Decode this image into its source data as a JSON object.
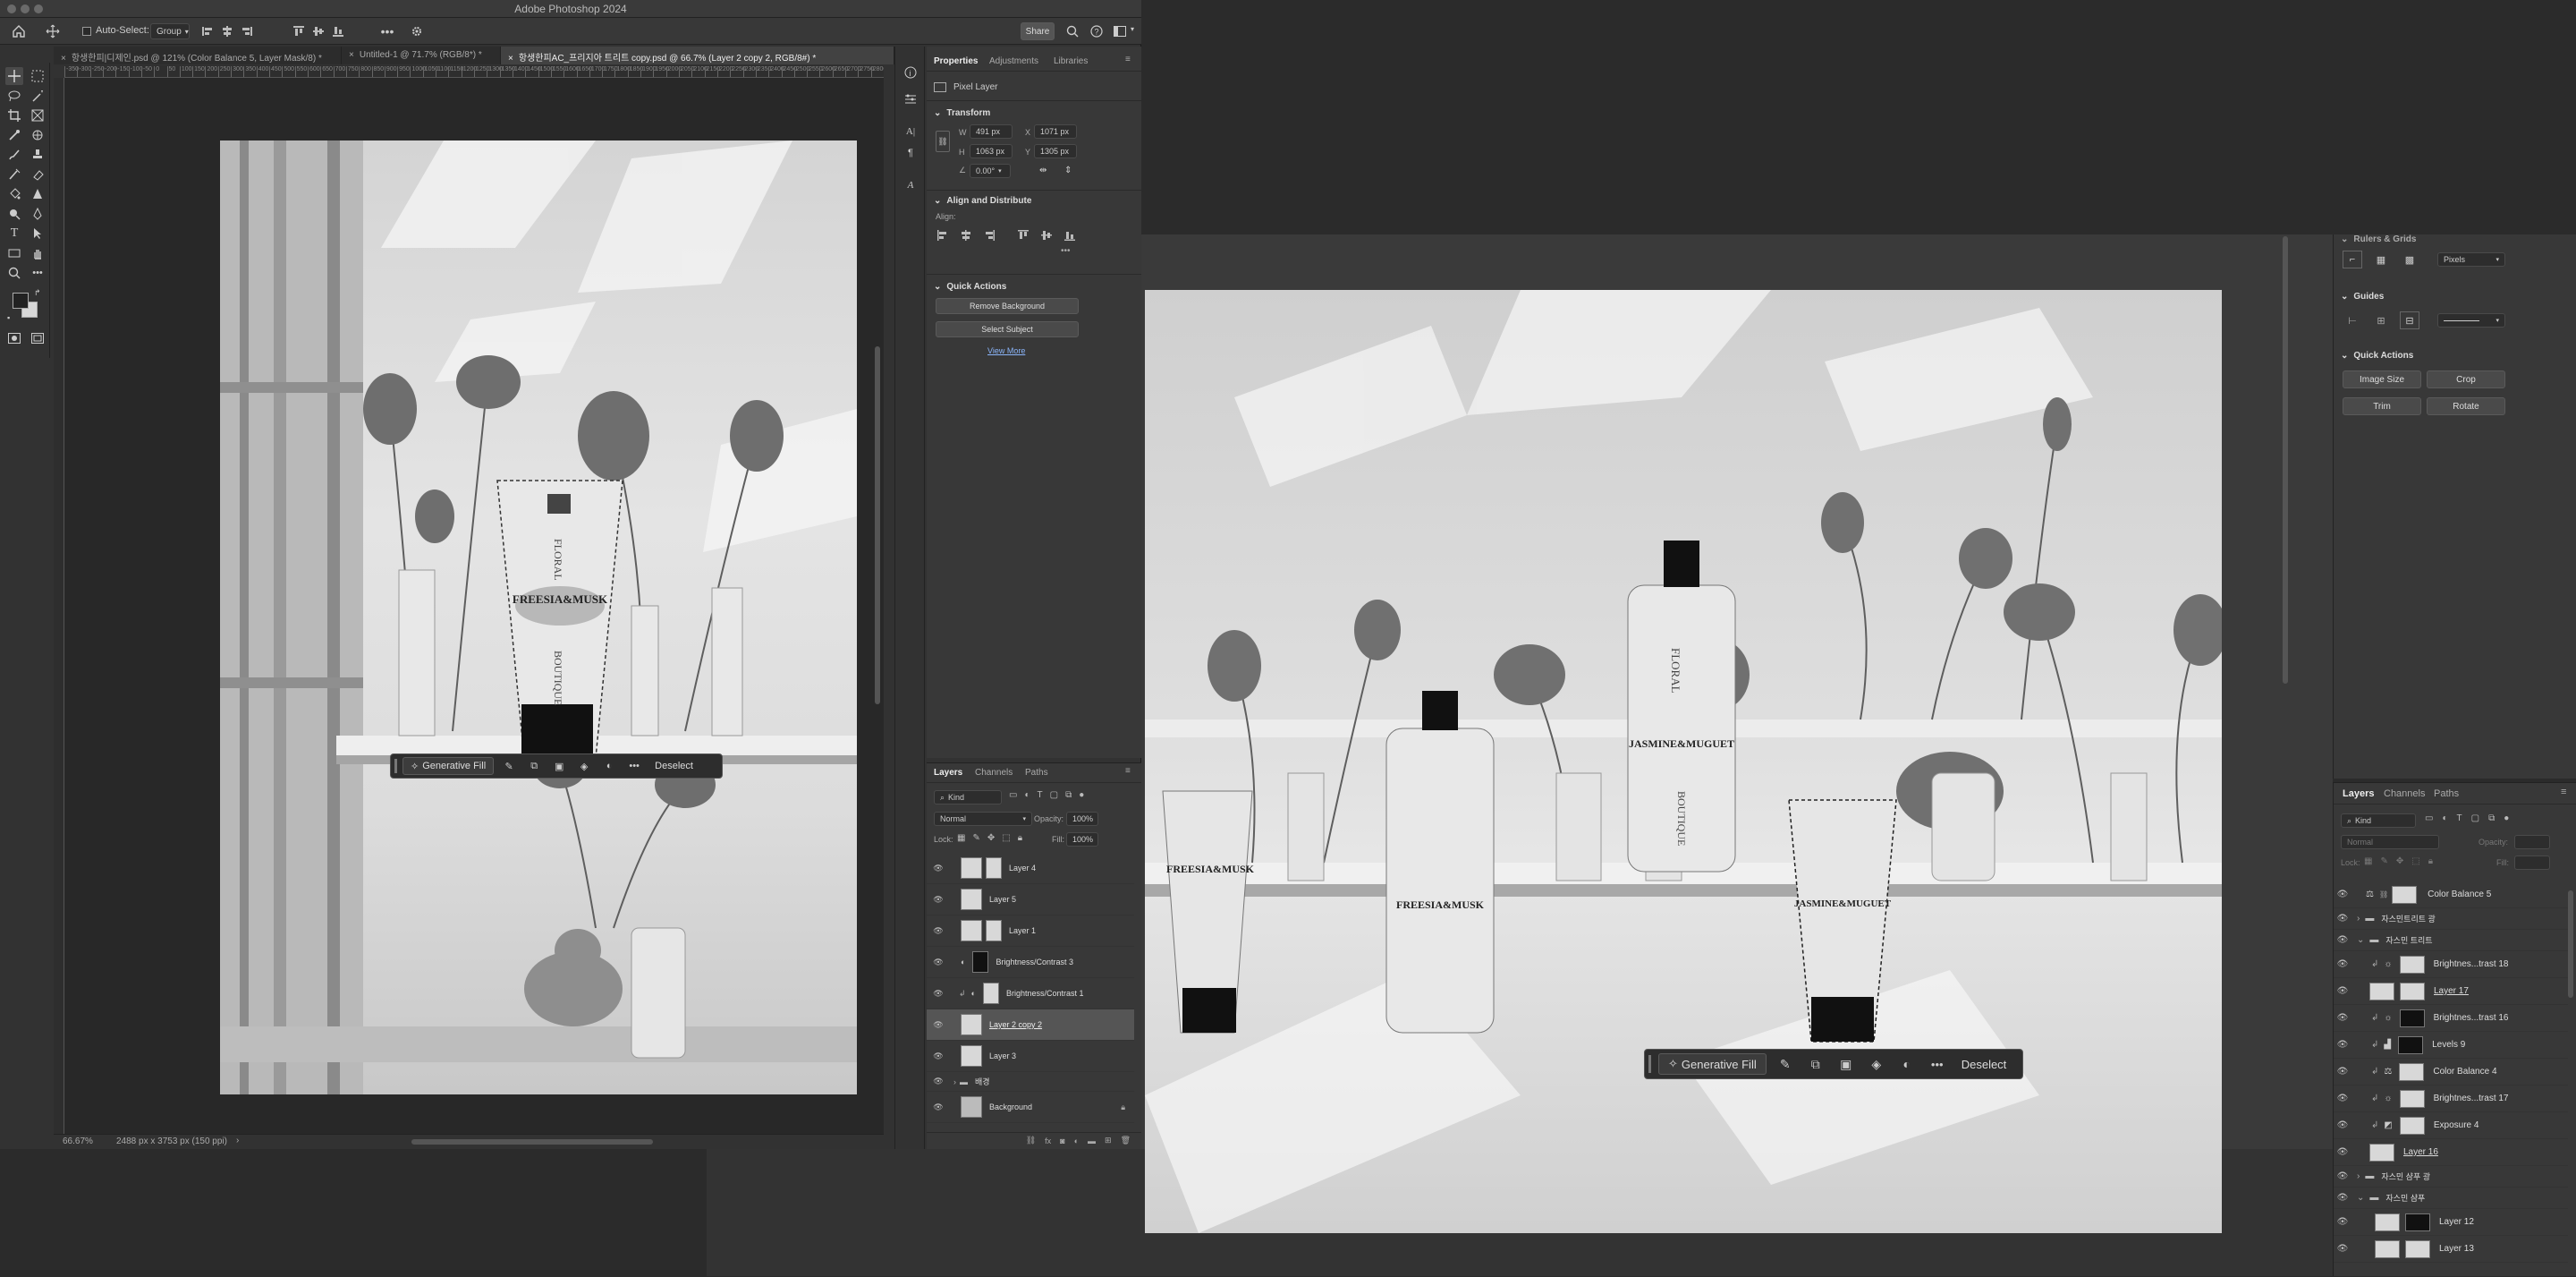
{
  "app": {
    "title": "Adobe Photoshop 2024"
  },
  "options_bar": {
    "auto_select_label": "Auto-Select:",
    "group_value": "Group",
    "share_label": "Share"
  },
  "tabs": [
    {
      "label": "항생한피|디제인.psd @ 121% (Color Balance 5, Layer Mask/8) *"
    },
    {
      "label": "Untitled-1 @ 71.7% (RGB/8*) *"
    },
    {
      "label": "항생한피AC_프리지아 트리트 copy.psd @ 66.7% (Layer 2 copy 2, RGB/8#) *"
    }
  ],
  "ruler_numbers": [
    "-350",
    "-300",
    "-250",
    "-200",
    "-150",
    "-100",
    "-50",
    "0",
    "50",
    "100",
    "150",
    "200",
    "250",
    "300",
    "350",
    "400",
    "450",
    "500",
    "550",
    "600",
    "650",
    "700",
    "750",
    "800",
    "850",
    "900",
    "950",
    "1000",
    "1050",
    "1100",
    "1150",
    "1200",
    "1250",
    "1300",
    "1350",
    "1400",
    "1450",
    "1500",
    "1550",
    "1600",
    "1650",
    "1700",
    "1750",
    "1800",
    "1850",
    "1900",
    "1950",
    "2000",
    "2050",
    "2100",
    "2150",
    "2200",
    "2250",
    "2300",
    "2350",
    "2400",
    "2450",
    "2500",
    "2550",
    "2600",
    "2650",
    "2700",
    "2750",
    "2800"
  ],
  "status_bar": {
    "zoom": "66.67%",
    "doc_info": "2488 px x 3753 px (150 ppi)"
  },
  "properties": {
    "tabs": [
      "Properties",
      "Adjustments",
      "Libraries"
    ],
    "layer_type": "Pixel Layer",
    "transform_title": "Transform",
    "w_label": "W",
    "w_value": "491 px",
    "x_label": "X",
    "x_value": "1071 px",
    "h_label": "H",
    "h_value": "1063 px",
    "y_label": "Y",
    "y_value": "1305 px",
    "angle_value": "0.00°",
    "align_title": "Align and Distribute",
    "align_label": "Align:",
    "quick_title": "Quick Actions",
    "remove_bg": "Remove Background",
    "select_subject": "Select Subject",
    "view_more": "View More"
  },
  "contextual_bar": {
    "generative_fill": "Generative Fill",
    "deselect": "Deselect"
  },
  "layers_panel": {
    "tabs": [
      "Layers",
      "Channels",
      "Paths"
    ],
    "kind": "Kind",
    "blend": "Normal",
    "opacity_label": "Opacity:",
    "opacity_value": "100%",
    "lock_label": "Lock:",
    "fill_label": "Fill:",
    "fill_value": "100%",
    "layers": [
      {
        "name": "Layer 4"
      },
      {
        "name": "Layer 5"
      },
      {
        "name": "Layer 1"
      },
      {
        "name": "Brightness/Contrast 3"
      },
      {
        "name": "Brightness/Contrast 1"
      },
      {
        "name": "Layer 2 copy 2"
      },
      {
        "name": "Layer 3"
      },
      {
        "name": "배경"
      },
      {
        "name": "Background"
      }
    ]
  },
  "right_props": {
    "rulers_title": "Rulers & Grids",
    "units": "Pixels",
    "guides_title": "Guides",
    "quick_title": "Quick Actions",
    "image_size": "Image Size",
    "crop": "Crop",
    "trim": "Trim",
    "rotate": "Rotate"
  },
  "right_layers": {
    "tabs": [
      "Layers",
      "Channels",
      "Paths"
    ],
    "kind": "Kind",
    "blend": "Normal",
    "opacity_label": "Opacity:",
    "fill_label": "Fill:",
    "lock_label": "Lock:",
    "layers": [
      {
        "name": "Color Balance 5"
      },
      {
        "name": "자스민트리트 광"
      },
      {
        "name": "자스민 트리트"
      },
      {
        "name": "Brightnes...trast 18"
      },
      {
        "name": "Layer 17"
      },
      {
        "name": "Brightnes...trast 16"
      },
      {
        "name": "Levels 9"
      },
      {
        "name": "Color Balance 4"
      },
      {
        "name": "Brightnes...trast 17"
      },
      {
        "name": "Exposure 4"
      },
      {
        "name": "Layer 16"
      },
      {
        "name": "자스민 샴푸 광"
      },
      {
        "name": "자스민 샴푸"
      },
      {
        "name": "Layer 12"
      },
      {
        "name": "Layer 13"
      }
    ]
  },
  "product_labels": {
    "freesia": "FREESIA&MUSK",
    "jasmine": "JASMINE&MUGUET",
    "floral": "FLORAL",
    "boutique": "BOUTIQUE"
  }
}
